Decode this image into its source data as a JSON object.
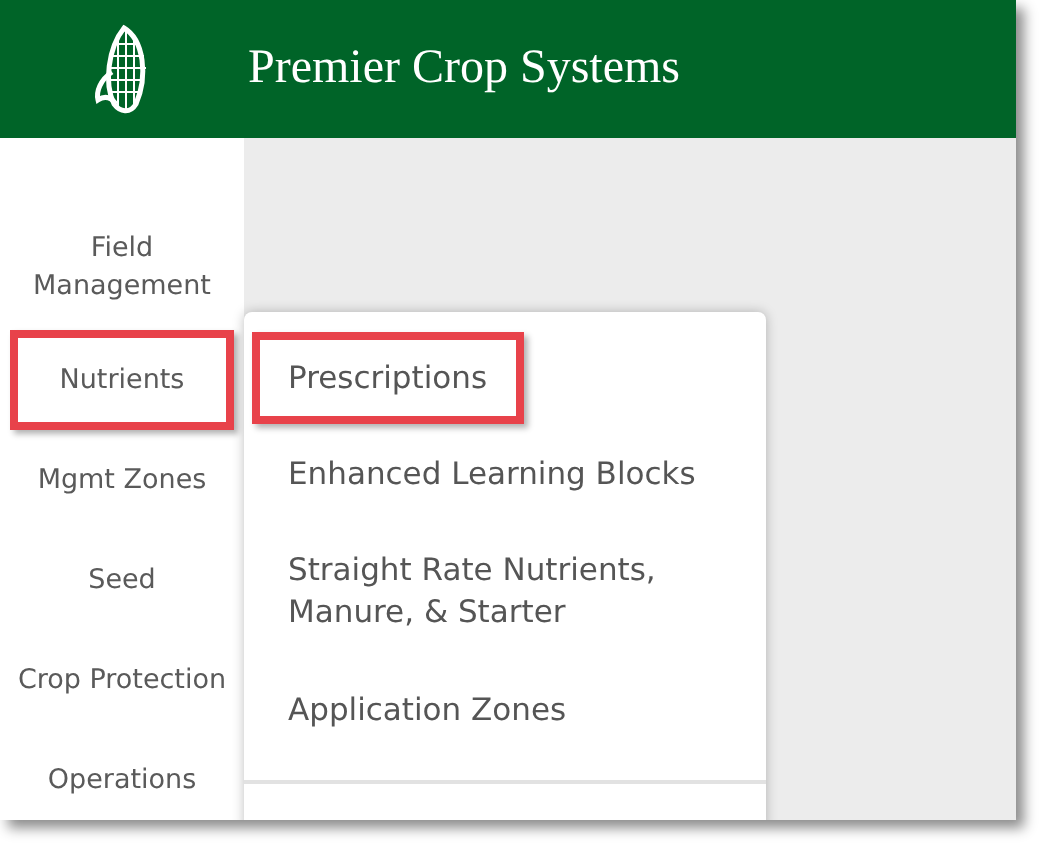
{
  "header": {
    "title": "Premier Crop Systems"
  },
  "sidebar": {
    "items": [
      {
        "label": "Field Management",
        "highlighted": false
      },
      {
        "label": "Nutrients",
        "highlighted": true
      },
      {
        "label": "Mgmt Zones",
        "highlighted": false
      },
      {
        "label": "Seed",
        "highlighted": false
      },
      {
        "label": "Crop Protection",
        "highlighted": false
      },
      {
        "label": "Operations",
        "highlighted": false
      }
    ]
  },
  "menu": {
    "items": [
      {
        "label": "Prescriptions",
        "highlighted": true
      },
      {
        "label": "Enhanced Learning Blocks",
        "highlighted": false
      },
      {
        "label": "Straight Rate Nutrients, Manure, & Starter",
        "highlighted": false
      },
      {
        "label": "Application Zones",
        "highlighted": false
      }
    ]
  }
}
